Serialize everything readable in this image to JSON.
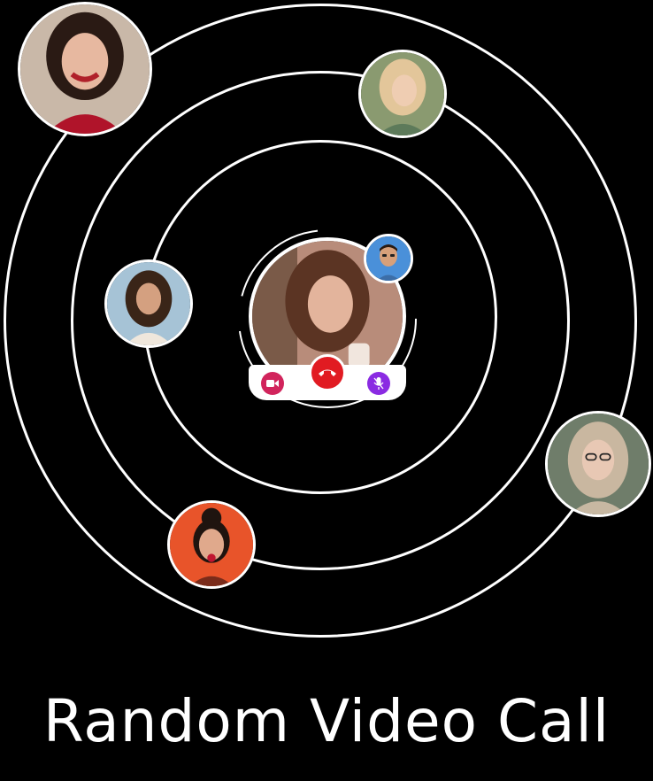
{
  "title": "Random Video Call",
  "colors": {
    "background": "#000000",
    "ring": "#ffffff",
    "end_call": "#e11b22",
    "video_button": "#d1245c",
    "mic_button": "#8a2be2"
  },
  "icons": {
    "end_call": "phone-hangup-icon",
    "video": "video-camera-icon",
    "mic": "mic-off-icon"
  }
}
